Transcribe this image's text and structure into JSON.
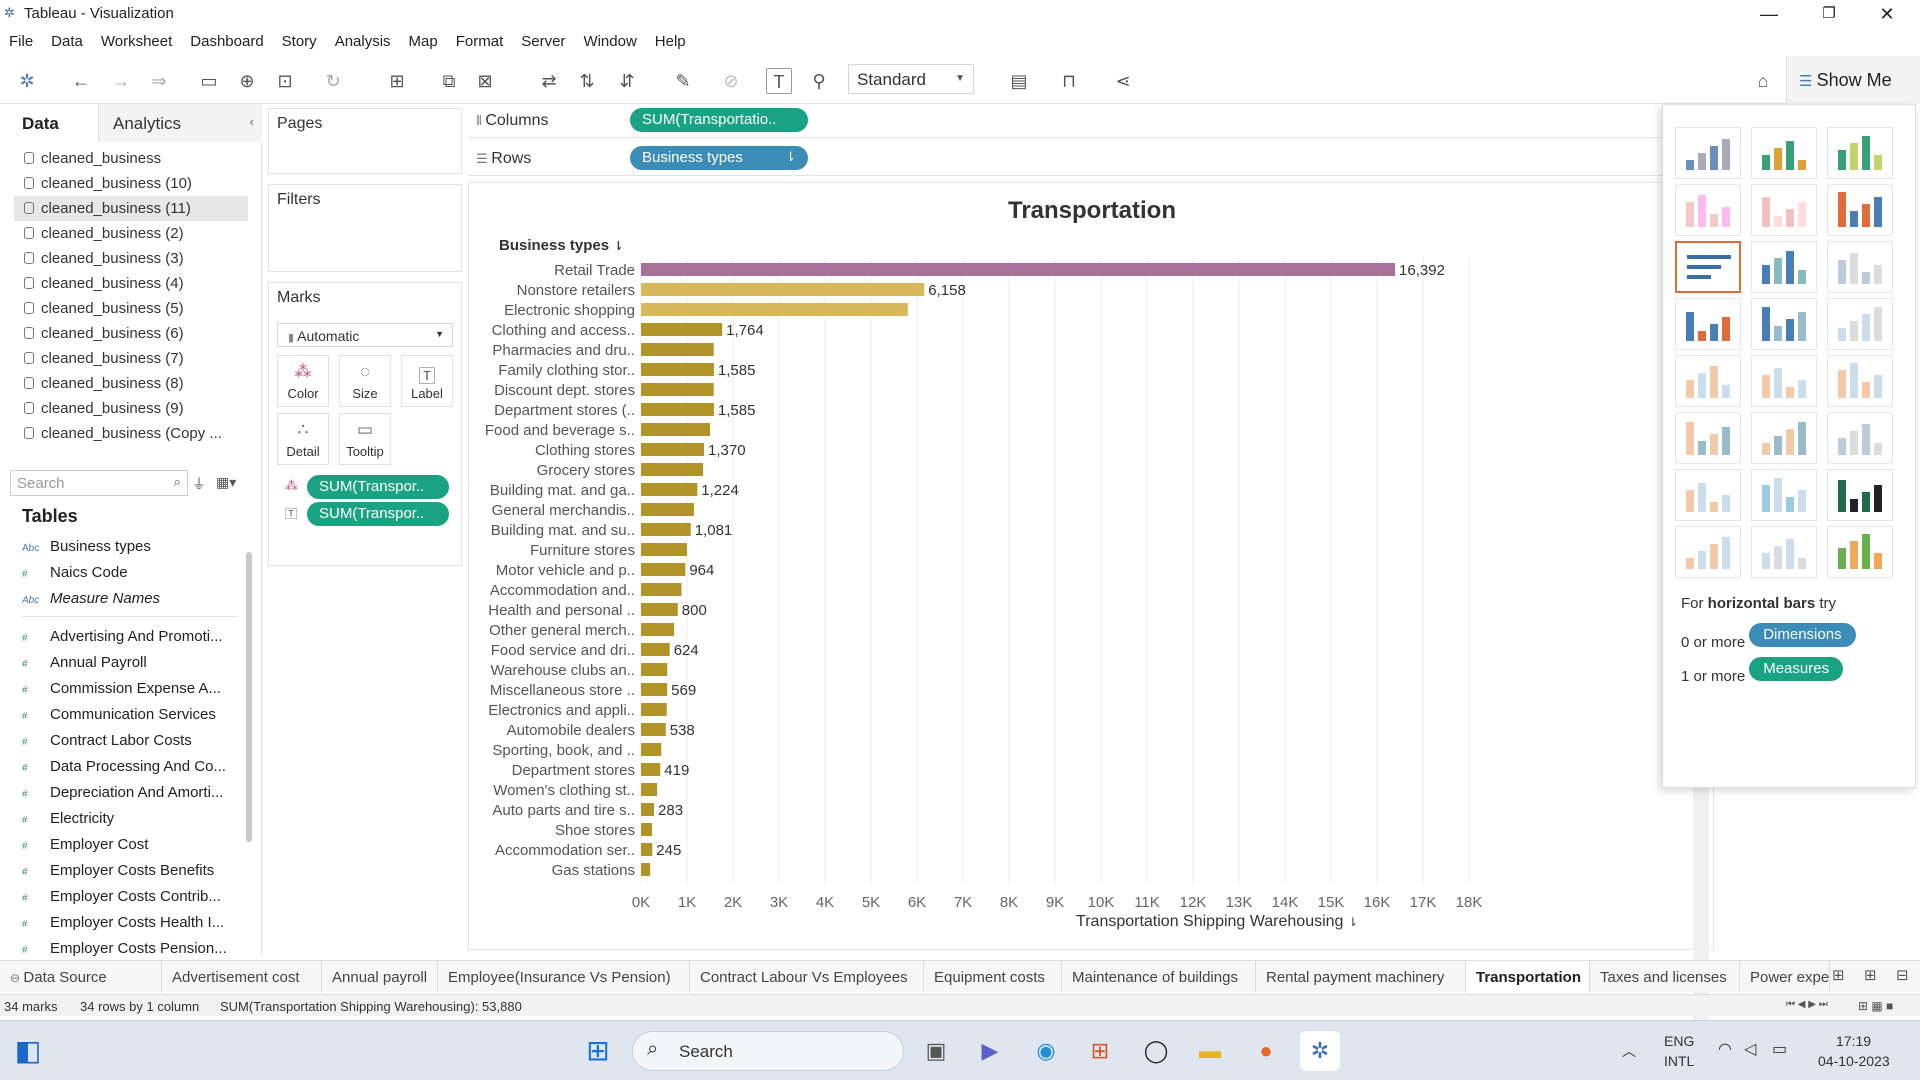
{
  "window": {
    "title": "Tableau - Visualization"
  },
  "menu": [
    "File",
    "Data",
    "Worksheet",
    "Dashboard",
    "Story",
    "Analysis",
    "Map",
    "Format",
    "Server",
    "Window",
    "Help"
  ],
  "toolbar": {
    "fit": "Standard",
    "show_me": "Show Me"
  },
  "left_pane": {
    "tabs": [
      "Data",
      "Analytics"
    ],
    "datasources": [
      "cleaned_business",
      "cleaned_business (10)",
      "cleaned_business (11)",
      "cleaned_business (2)",
      "cleaned_business (3)",
      "cleaned_business (4)",
      "cleaned_business (5)",
      "cleaned_business (6)",
      "cleaned_business (7)",
      "cleaned_business (8)",
      "cleaned_business (9)",
      "cleaned_business (Copy ..."
    ],
    "selected_datasource": "cleaned_business (11)",
    "search_placeholder": "Search",
    "tables_header": "Tables",
    "dimensions": [
      {
        "type": "Abc",
        "name": "Business types"
      },
      {
        "type": "#",
        "name": "Naics Code"
      },
      {
        "type": "Abc",
        "name": "Measure Names"
      }
    ],
    "measures": [
      "Advertising And Promoti...",
      "Annual Payroll",
      "Commission Expense A...",
      "Communication Services",
      "Contract Labor Costs",
      "Data Processing And Co...",
      "Depreciation And Amorti...",
      "Electricity",
      "Employer Cost",
      "Employer Costs Benefits",
      "Employer Costs Contrib...",
      "Employer Costs Health I...",
      "Employer Costs Pension..."
    ]
  },
  "cards": {
    "pages": "Pages",
    "filters": "Filters",
    "marks": "Marks",
    "mark_type": "Automatic",
    "mark_buttons": [
      "Color",
      "Size",
      "Label",
      "Detail",
      "Tooltip"
    ],
    "mark_pills": [
      "SUM(Transpor..",
      "SUM(Transpor.."
    ]
  },
  "shelves": {
    "columns_label": "Columns",
    "columns_pill": "SUM(Transportatio..",
    "rows_label": "Rows",
    "rows_pill": "Business types"
  },
  "chart_data": {
    "type": "bar",
    "orientation": "horizontal",
    "title": "Transportation",
    "row_header": "Business types",
    "xlabel": "Transportation Shipping Warehousing",
    "xlim": [
      0,
      18000
    ],
    "x_ticks": [
      "0K",
      "1K",
      "2K",
      "3K",
      "4K",
      "5K",
      "6K",
      "7K",
      "8K",
      "9K",
      "10K",
      "11K",
      "12K",
      "13K",
      "14K",
      "15K",
      "16K",
      "17K",
      "18K"
    ],
    "categories": [
      "Retail Trade",
      "Nonstore retailers",
      "Electronic shopping",
      "Clothing and access..",
      "Pharmacies and dru..",
      "Family clothing stor..",
      "Discount dept. stores",
      "Department stores (..",
      "Food and beverage s..",
      "Clothing stores",
      "Grocery stores",
      "Building mat. and ga..",
      "General merchandis..",
      "Building mat. and su..",
      "Furniture stores",
      "Motor vehicle and p..",
      "Accommodation and..",
      "Health and personal ..",
      "Other general merch..",
      "Food service and dri..",
      "Warehouse clubs an..",
      "Miscellaneous store ..",
      "Electronics and appli..",
      "Automobile dealers",
      "Sporting, book, and ..",
      "Department stores",
      "Women's clothing st..",
      "Auto parts and tire s..",
      "Shoe stores",
      "Accommodation ser..",
      "Gas stations"
    ],
    "values": [
      16392,
      6158,
      5800,
      1764,
      1580,
      1585,
      1580,
      1585,
      1500,
      1370,
      1350,
      1224,
      1150,
      1081,
      1000,
      964,
      880,
      800,
      720,
      624,
      570,
      569,
      560,
      538,
      440,
      419,
      350,
      283,
      240,
      245,
      200
    ],
    "labels": [
      "16,392",
      "6,158",
      "",
      "1,764",
      "",
      "1,585",
      "",
      "1,585",
      "",
      "1,370",
      "",
      "1,224",
      "",
      "1,081",
      "",
      "964",
      "",
      "800",
      "",
      "624",
      "",
      "569",
      "",
      "538",
      "",
      "419",
      "",
      "283",
      "",
      "245",
      ""
    ],
    "colors": {
      "top": "#a87198",
      "second": "#d7b95b",
      "rest": "#b09428"
    }
  },
  "show_me": {
    "hint_prefix": "For ",
    "hint_bold": "horizontal bars",
    "hint_suffix": " try",
    "dim_prefix": "0 or more",
    "dim_pill": "Dimensions",
    "meas_prefix": "1 or more",
    "meas_pill": "Measures"
  },
  "sheets": [
    "Data Source",
    "Advertisement cost",
    "Annual payroll",
    "Employee(Insurance  Vs Pension)",
    "Contract Labour Vs Employees",
    "Equipment costs",
    "Maintenance of buildings",
    "Rental payment machinery",
    "Transportation",
    "Taxes and licenses",
    "Power expe"
  ],
  "active_sheet": "Transportation",
  "status": {
    "marks": "34 marks",
    "dims": "34 rows by 1 column",
    "sum": "SUM(Transportation Shipping Warehousing): 53,880"
  },
  "taskbar": {
    "search": "Search",
    "lang1": "ENG",
    "lang2": "INTL",
    "time": "17:19",
    "date": "04-10-2023"
  }
}
